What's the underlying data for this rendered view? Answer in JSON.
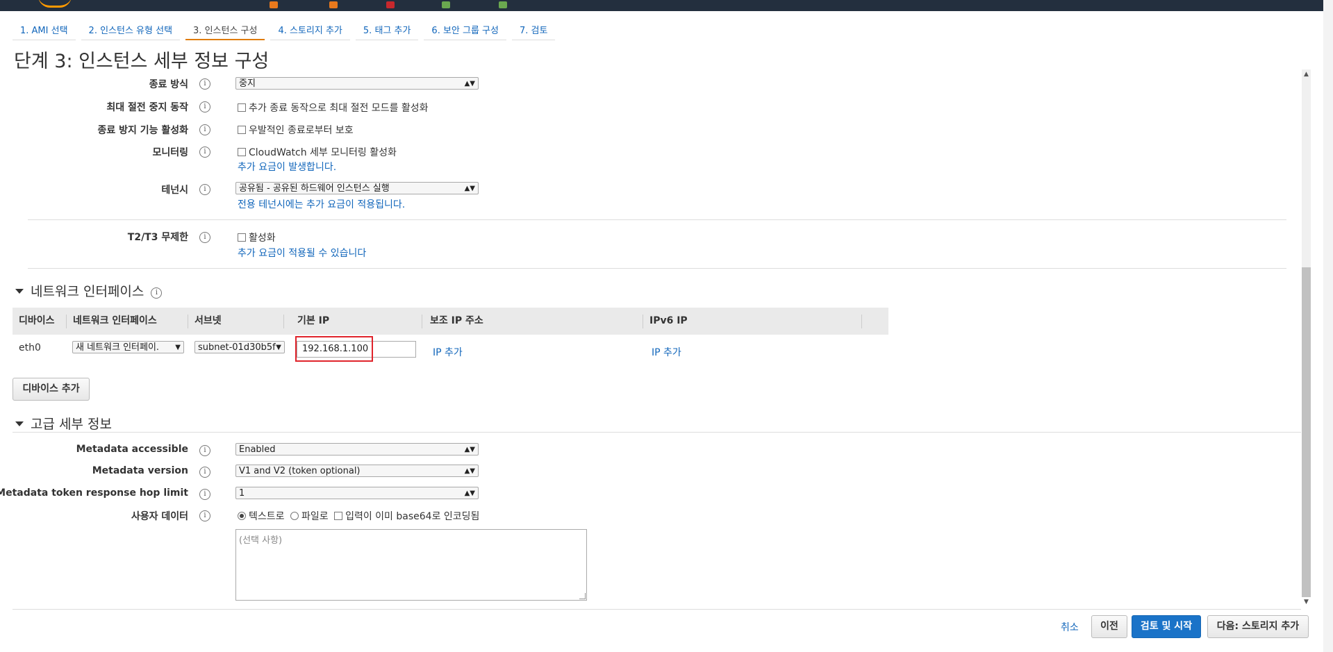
{
  "steps": [
    {
      "label": "1. AMI 선택"
    },
    {
      "label": "2. 인스턴스 유형 선택"
    },
    {
      "label": "3. 인스턴스 구성"
    },
    {
      "label": "4. 스토리지 추가"
    },
    {
      "label": "5. 태그 추가"
    },
    {
      "label": "6. 보안 그룹 구성"
    },
    {
      "label": "7. 검토"
    }
  ],
  "page_title": "단계 3: 인스턴스 세부 정보 구성",
  "settings": {
    "shutdown": {
      "label": "종료 방식",
      "value": "중지"
    },
    "hibernate": {
      "label": "최대 절전 중지 동작",
      "checkbox": "추가 종료 동작으로 최대 절전 모드를 활성화"
    },
    "termination_protection": {
      "label": "종료 방지 기능 활성화",
      "checkbox": "우발적인 종료로부터 보호"
    },
    "monitoring": {
      "label": "모니터링",
      "checkbox": "CloudWatch 세부 모니터링 활성화",
      "note": "추가 요금이 발생합니다."
    },
    "tenancy": {
      "label": "테넌시",
      "value": "공유됨 - 공유된 하드웨어 인스턴스 실행",
      "note": "전용 테넌시에는 추가 요금이 적용됩니다."
    },
    "t2t3": {
      "label": "T2/T3 무제한",
      "checkbox": "활성화",
      "note": "추가 요금이 적용될 수 있습니다"
    }
  },
  "network": {
    "title": "네트워크 인터페이스",
    "headers": [
      "디바이스",
      "네트워크 인터페이스",
      "서브넷",
      "기본 IP",
      "보조 IP 주소",
      "IPv6 IP"
    ],
    "row": {
      "device": "eth0",
      "interface": "새 네트워크 인터페이.",
      "subnet": "subnet-01d30b5f",
      "primary_ip": "192.168.1.100",
      "secondary_ip_link": "IP 추가",
      "ipv6_link": "IP 추가"
    },
    "add_device_button": "디바이스 추가"
  },
  "advanced": {
    "title": "고급 세부 정보",
    "metadata_accessible": {
      "label": "Metadata accessible",
      "value": "Enabled"
    },
    "metadata_version": {
      "label": "Metadata version",
      "value": "V1 and V2 (token optional)"
    },
    "hop_limit": {
      "label": "Metadata token response hop limit",
      "value": "1"
    },
    "user_data": {
      "label": "사용자 데이터",
      "option_text": "텍스트로",
      "option_file": "파일로",
      "base64_checkbox": "입력이 이미 base64로 인코딩됨",
      "placeholder": "(선택 사항)"
    }
  },
  "footer": {
    "cancel": "취소",
    "previous": "이전",
    "review_launch": "검토 및 시작",
    "next": "다음: 스토리지 추가"
  },
  "colors": {
    "topbar": "#232f3e",
    "link": "#1166bb",
    "primary_button": "#1a73c8",
    "highlight_box": "#e0232b",
    "active_tab_underline": "#e07b00"
  }
}
